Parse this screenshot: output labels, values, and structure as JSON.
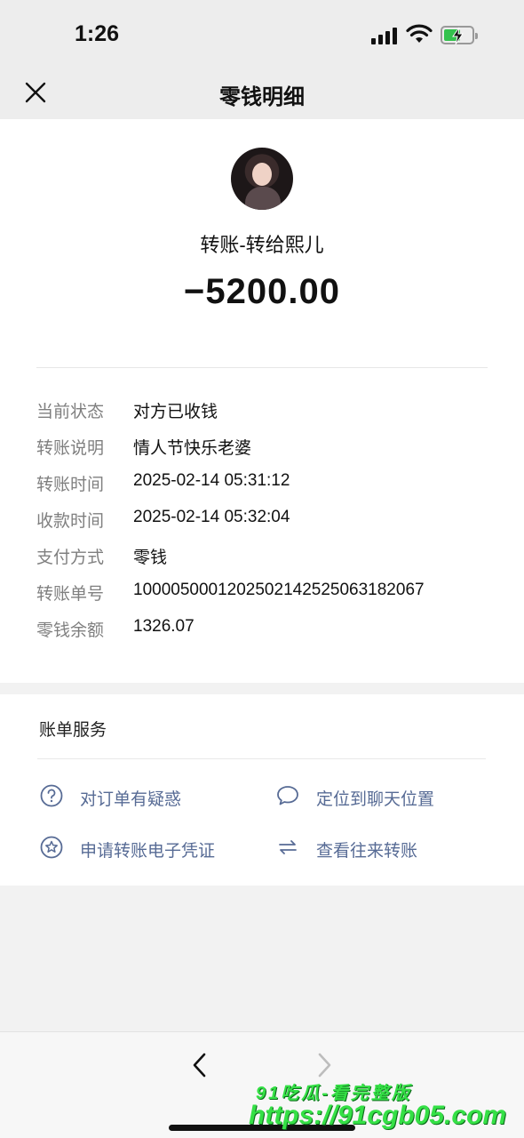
{
  "status_bar": {
    "time": "1:26"
  },
  "nav": {
    "title": "零钱明细",
    "close_icon": "close-icon"
  },
  "transfer": {
    "title": "转账-转给熙儿",
    "amount": "−5200.00"
  },
  "details": [
    {
      "label": "当前状态",
      "value": "对方已收钱"
    },
    {
      "label": "转账说明",
      "value": "情人节快乐老婆"
    },
    {
      "label": "转账时间",
      "value": "2025-02-14 05:31:12"
    },
    {
      "label": "收款时间",
      "value": "2025-02-14 05:32:04"
    },
    {
      "label": "支付方式",
      "value": "零钱"
    },
    {
      "label": "转账单号",
      "value": "10000500012025021425250631820​67"
    },
    {
      "label": "零钱余额",
      "value": "1326.07"
    }
  ],
  "service": {
    "title": "账单服务",
    "items": [
      {
        "label": "对订单有疑惑",
        "icon": "question-icon"
      },
      {
        "label": "定位到聊天位置",
        "icon": "chat-bubble-icon"
      },
      {
        "label": "申请转账电子凭证",
        "icon": "star-badge-icon"
      },
      {
        "label": "查看往来转账",
        "icon": "transfer-arrows-icon"
      }
    ]
  },
  "watermark": {
    "line1": "91吃瓜-看完整版",
    "line2": "https://91cgb05.com"
  },
  "colors": {
    "link": "#576b95",
    "battery": "#33c24d",
    "watermark": "#35e046"
  }
}
